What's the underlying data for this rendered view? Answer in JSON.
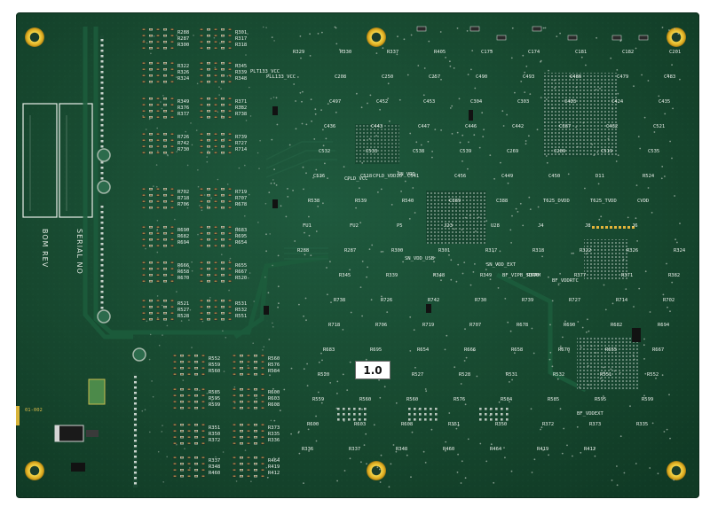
{
  "board": {
    "revision_label": "1.0",
    "bom_label": "BOM REV",
    "serial_label": "SERIAL NO",
    "marking_bottom_left": "01-002"
  },
  "designators": [
    "R288",
    "R287",
    "R300",
    "R301",
    "R317",
    "R318",
    "R322",
    "R326",
    "R324",
    "R345",
    "R339",
    "R348",
    "R349",
    "R376",
    "R377",
    "R371",
    "R382",
    "R738",
    "R726",
    "R742",
    "R730",
    "R739",
    "R727",
    "R714",
    "R702",
    "R718",
    "R706",
    "R719",
    "R707",
    "R678",
    "R690",
    "R682",
    "R694",
    "R683",
    "R695",
    "R654",
    "R666",
    "R658",
    "R670",
    "R655",
    "R667",
    "R520",
    "R521",
    "R527",
    "R528",
    "R531",
    "R532",
    "R551",
    "R552",
    "R559",
    "R560",
    "R560",
    "R576",
    "R584",
    "R585",
    "R595",
    "R599",
    "R600",
    "R603",
    "R608",
    "R351",
    "R350",
    "R372",
    "R373",
    "R335",
    "R336",
    "R337",
    "R348",
    "R460",
    "R464",
    "R419",
    "R412",
    "R329",
    "R330",
    "R337",
    "R405",
    "C175",
    "C174",
    "C181",
    "C182",
    "C201",
    "C208",
    "C250",
    "C257",
    "C490",
    "C493",
    "C486",
    "C479",
    "C483",
    "C497",
    "C452",
    "C453",
    "C304",
    "C303",
    "C423",
    "C424",
    "C435",
    "C436",
    "C443",
    "C447",
    "C446",
    "C442",
    "C387",
    "C432",
    "C521",
    "C532",
    "C533",
    "C538",
    "C539",
    "C269",
    "C289",
    "C519",
    "C535",
    "C536",
    "C518",
    "C541",
    "C456",
    "C449",
    "C450",
    "D11",
    "R524",
    "R538",
    "R539",
    "R540",
    "C389",
    "C388",
    "T625_DVDD",
    "T625_TVDD",
    "CVDD",
    "FU1",
    "FU2",
    "P5",
    "J23",
    "U28",
    "J4",
    "J8",
    "J6"
  ],
  "net_labels": [
    "PLT133_VCC",
    "PLL133_VCC",
    "CPLD_VCC",
    "CPLD_VDDIO",
    "SN_VDD",
    "SN_VDD_USB",
    "SN_VDD_EXT",
    "BF_VIPB_SDRAM",
    "BF_VDDRTC",
    "BF_VDDEXT"
  ]
}
